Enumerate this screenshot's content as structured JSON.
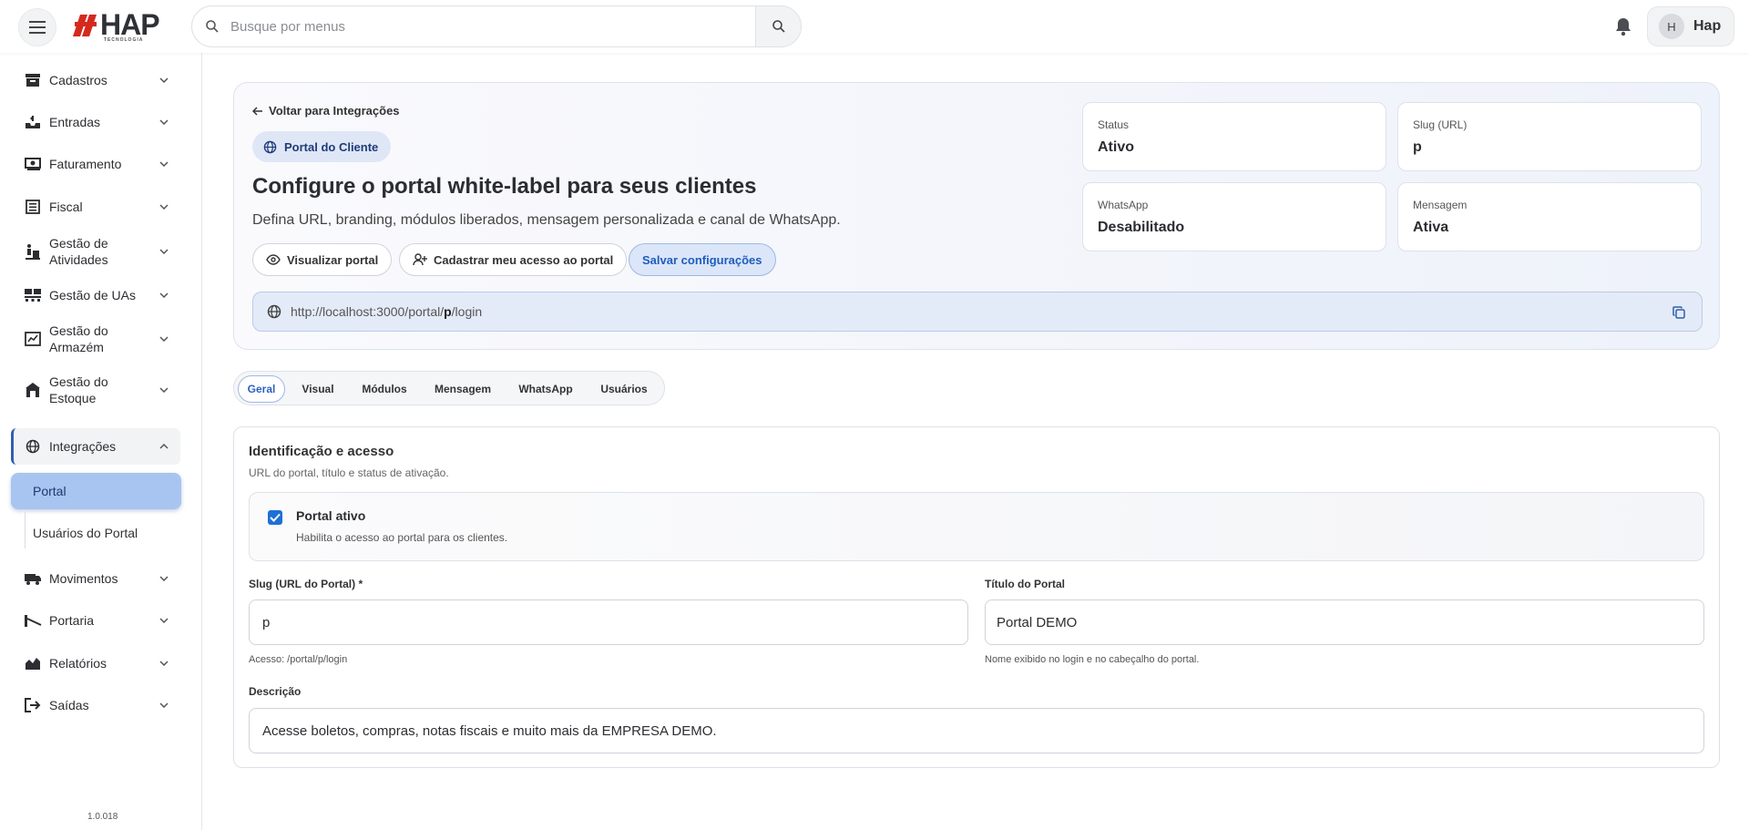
{
  "topbar": {
    "logo_text": "HAP",
    "logo_sub": "TECNOLOGIA",
    "search_placeholder": "Busque por menus",
    "user_initial": "H",
    "user_name": "Hap"
  },
  "sidebar": {
    "items": [
      {
        "label": "Cadastros",
        "icon": "archive-icon"
      },
      {
        "label": "Entradas",
        "icon": "inbox-icon"
      },
      {
        "label": "Faturamento",
        "icon": "money-icon"
      },
      {
        "label": "Fiscal",
        "icon": "list-icon"
      },
      {
        "label": "Gestão de Atividades",
        "icon": "activities-icon"
      },
      {
        "label": "Gestão de UAs",
        "icon": "pallet-icon"
      },
      {
        "label": "Gestão do Armazém",
        "icon": "warehouse-chart-icon"
      },
      {
        "label": "Gestão do Estoque",
        "icon": "store-icon"
      },
      {
        "label": "Integrações",
        "icon": "globe-icon"
      },
      {
        "label": "Movimentos",
        "icon": "truck-icon"
      },
      {
        "label": "Portaria",
        "icon": "gate-icon"
      },
      {
        "label": "Relatórios",
        "icon": "chart-icon"
      },
      {
        "label": "Saídas",
        "icon": "exit-icon"
      }
    ],
    "sub_items": [
      {
        "label": "Portal",
        "active": true
      },
      {
        "label": "Usuários do Portal",
        "active": false
      }
    ],
    "version": "1.0.018"
  },
  "hero": {
    "back_label": "Voltar para Integrações",
    "chip_label": "Portal do Cliente",
    "title": "Configure o portal white-label para seus clientes",
    "subtitle": "Defina URL, branding, módulos liberados, mensagem personalizada e canal de WhatsApp.",
    "buttons": {
      "view": "Visualizar portal",
      "register": "Cadastrar meu acesso ao portal",
      "save": "Salvar configurações"
    },
    "url_prefix": "http://localhost:3000/portal/",
    "url_slug": "p",
    "url_suffix": "/login",
    "stats": [
      {
        "label": "Status",
        "value": "Ativo"
      },
      {
        "label": "Slug (URL)",
        "value": "p"
      },
      {
        "label": "WhatsApp",
        "value": "Desabilitado"
      },
      {
        "label": "Mensagem",
        "value": "Ativa"
      }
    ]
  },
  "tabs": [
    "Geral",
    "Visual",
    "Módulos",
    "Mensagem",
    "WhatsApp",
    "Usuários"
  ],
  "active_tab": "Geral",
  "form": {
    "section_title": "Identificação e acesso",
    "section_subtitle": "URL do portal, título e status de ativação.",
    "portal_active_label": "Portal ativo",
    "portal_active_help": "Habilita o acesso ao portal para os clientes.",
    "portal_active_checked": true,
    "slug_label": "Slug (URL do Portal) *",
    "slug_value": "p",
    "slug_help": "Acesso: /portal/p/login",
    "title_label": "Título do Portal",
    "title_value": "Portal DEMO",
    "title_help": "Nome exibido no login e no cabeçalho do portal.",
    "description_label": "Descrição",
    "description_value": "Acesse boletos, compras, notas fiscais e muito mais da EMPRESA DEMO."
  },
  "colors": {
    "accent": "#1f6fd6",
    "active_sub_bg": "#a8c4f0",
    "primary_button_text": "#1f5dbd"
  }
}
